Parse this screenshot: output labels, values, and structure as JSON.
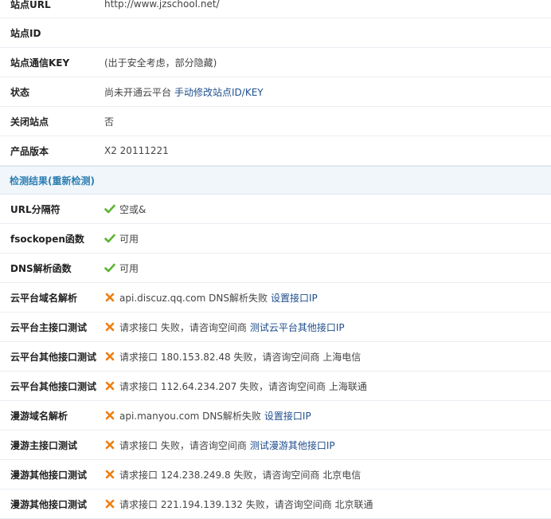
{
  "info_rows": [
    {
      "label": "站点URL",
      "value": "http://www.jzschool.net/",
      "link": ""
    },
    {
      "label": "站点ID",
      "value": "",
      "link": ""
    },
    {
      "label": "站点通信KEY",
      "value": "(出于安全考虑，部分隐藏)",
      "link": ""
    },
    {
      "label": "状态",
      "value": "尚未开通云平台",
      "link": "手动修改站点ID/KEY"
    },
    {
      "label": "关闭站点",
      "value": "否",
      "link": ""
    },
    {
      "label": "产品版本",
      "value": "X2 20111221",
      "link": ""
    }
  ],
  "section": {
    "title": "检测结果(重新检测)"
  },
  "check_rows": [
    {
      "label": "URL分隔符",
      "status": "ok",
      "icon": "check-icon",
      "value": "空或&",
      "link": ""
    },
    {
      "label": "fsockopen函数",
      "status": "ok",
      "icon": "check-icon",
      "value": "可用",
      "link": ""
    },
    {
      "label": "DNS解析函数",
      "status": "ok",
      "icon": "check-icon",
      "value": "可用",
      "link": ""
    },
    {
      "label": "云平台域名解析",
      "status": "fail",
      "icon": "cross-icon",
      "value": "api.discuz.qq.com DNS解析失败",
      "link": "设置接口IP"
    },
    {
      "label": "云平台主接口测试",
      "status": "fail",
      "icon": "cross-icon",
      "value": "请求接口 失败，请咨询空间商",
      "link": "测试云平台其他接口IP"
    },
    {
      "label": "云平台其他接口测试",
      "status": "fail",
      "icon": "cross-icon",
      "value": "请求接口 180.153.82.48 失败，请咨询空间商 上海电信",
      "link": ""
    },
    {
      "label": "云平台其他接口测试",
      "status": "fail",
      "icon": "cross-icon",
      "value": "请求接口 112.64.234.207 失败，请咨询空间商 上海联通",
      "link": ""
    },
    {
      "label": "漫游域名解析",
      "status": "fail",
      "icon": "cross-icon",
      "value": "api.manyou.com DNS解析失败",
      "link": "设置接口IP"
    },
    {
      "label": "漫游主接口测试",
      "status": "fail",
      "icon": "cross-icon",
      "value": "请求接口 失败，请咨询空间商",
      "link": "测试漫游其他接口IP"
    },
    {
      "label": "漫游其他接口测试",
      "status": "fail",
      "icon": "cross-icon",
      "value": "请求接口 124.238.249.8 失败，请咨询空间商 北京电信",
      "link": ""
    },
    {
      "label": "漫游其他接口测试",
      "status": "fail",
      "icon": "cross-icon",
      "value": "请求接口 221.194.139.132 失败，请咨询空间商 北京联通",
      "link": ""
    }
  ],
  "colors": {
    "check": "#5cb531",
    "cross": "#f07d10",
    "link": "#1f4e8c",
    "section_text": "#2d7fb2"
  }
}
